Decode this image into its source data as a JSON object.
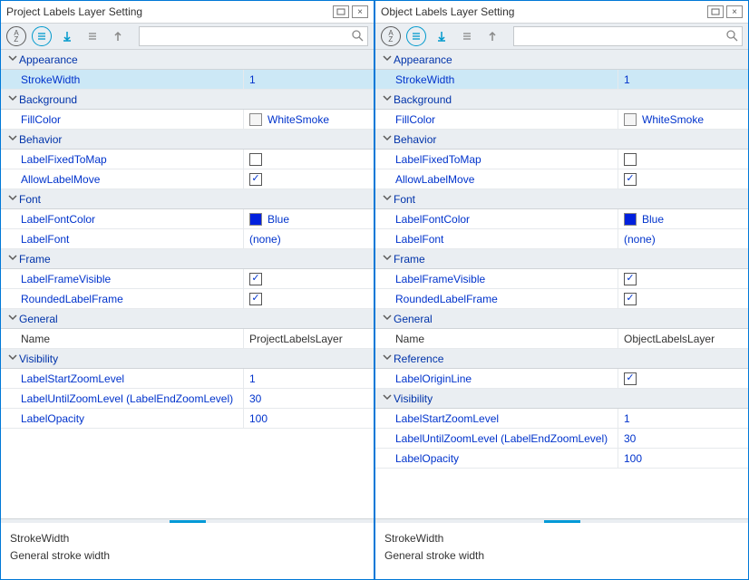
{
  "panels": [
    {
      "title": "Project Labels Layer Setting",
      "selectedKey": "StrokeWidth",
      "description": {
        "name": "StrokeWidth",
        "text": "General stroke width"
      },
      "groups": [
        {
          "name": "Appearance",
          "rows": [
            {
              "label": "StrokeWidth",
              "value": "1",
              "type": "text",
              "selected": true
            }
          ]
        },
        {
          "name": "Background",
          "rows": [
            {
              "label": "FillColor",
              "value": "WhiteSmoke",
              "type": "color",
              "color": "#f5f5f5"
            }
          ]
        },
        {
          "name": "Behavior",
          "rows": [
            {
              "label": "LabelFixedToMap",
              "value": "",
              "type": "check",
              "checked": false
            },
            {
              "label": "AllowLabelMove",
              "value": "",
              "type": "check",
              "checked": true
            }
          ]
        },
        {
          "name": "Font",
          "rows": [
            {
              "label": "LabelFontColor",
              "value": "Blue",
              "type": "color",
              "color": "#0020dd"
            },
            {
              "label": "LabelFont",
              "value": "(none)",
              "type": "text"
            }
          ]
        },
        {
          "name": "Frame",
          "rows": [
            {
              "label": "LabelFrameVisible",
              "value": "",
              "type": "check",
              "checked": true
            },
            {
              "label": "RoundedLabelFrame",
              "value": "",
              "type": "check",
              "checked": true
            }
          ]
        },
        {
          "name": "General",
          "rows": [
            {
              "label": "Name",
              "value": "ProjectLabelsLayer",
              "type": "text",
              "plain": true
            }
          ]
        },
        {
          "name": "Visibility",
          "rows": [
            {
              "label": "LabelStartZoomLevel",
              "value": "1",
              "type": "text"
            },
            {
              "label": "LabelUntilZoomLevel (LabelEndZoomLevel)",
              "value": "30",
              "type": "text"
            },
            {
              "label": "LabelOpacity",
              "value": "100",
              "type": "text"
            }
          ]
        }
      ]
    },
    {
      "title": "Object Labels Layer Setting",
      "selectedKey": "StrokeWidth",
      "description": {
        "name": "StrokeWidth",
        "text": "General stroke width"
      },
      "groups": [
        {
          "name": "Appearance",
          "rows": [
            {
              "label": "StrokeWidth",
              "value": "1",
              "type": "text",
              "selected": true
            }
          ]
        },
        {
          "name": "Background",
          "rows": [
            {
              "label": "FillColor",
              "value": "WhiteSmoke",
              "type": "color",
              "color": "#f5f5f5"
            }
          ]
        },
        {
          "name": "Behavior",
          "rows": [
            {
              "label": "LabelFixedToMap",
              "value": "",
              "type": "check",
              "checked": false
            },
            {
              "label": "AllowLabelMove",
              "value": "",
              "type": "check",
              "checked": true
            }
          ]
        },
        {
          "name": "Font",
          "rows": [
            {
              "label": "LabelFontColor",
              "value": "Blue",
              "type": "color",
              "color": "#0020dd"
            },
            {
              "label": "LabelFont",
              "value": "(none)",
              "type": "text"
            }
          ]
        },
        {
          "name": "Frame",
          "rows": [
            {
              "label": "LabelFrameVisible",
              "value": "",
              "type": "check",
              "checked": true
            },
            {
              "label": "RoundedLabelFrame",
              "value": "",
              "type": "check",
              "checked": true
            }
          ]
        },
        {
          "name": "General",
          "rows": [
            {
              "label": "Name",
              "value": "ObjectLabelsLayer",
              "type": "text",
              "plain": true
            }
          ]
        },
        {
          "name": "Reference",
          "rows": [
            {
              "label": "LabelOriginLine",
              "value": "",
              "type": "check",
              "checked": true
            }
          ]
        },
        {
          "name": "Visibility",
          "rows": [
            {
              "label": "LabelStartZoomLevel",
              "value": "1",
              "type": "text"
            },
            {
              "label": "LabelUntilZoomLevel (LabelEndZoomLevel)",
              "value": "30",
              "type": "text"
            },
            {
              "label": "LabelOpacity",
              "value": "100",
              "type": "text"
            }
          ]
        }
      ]
    }
  ],
  "icons": {
    "az": "A↕",
    "group": "≣",
    "down": "↓",
    "list": "≣",
    "up": "↑",
    "search": "🔍",
    "expand": "⌄",
    "check": "✓"
  }
}
